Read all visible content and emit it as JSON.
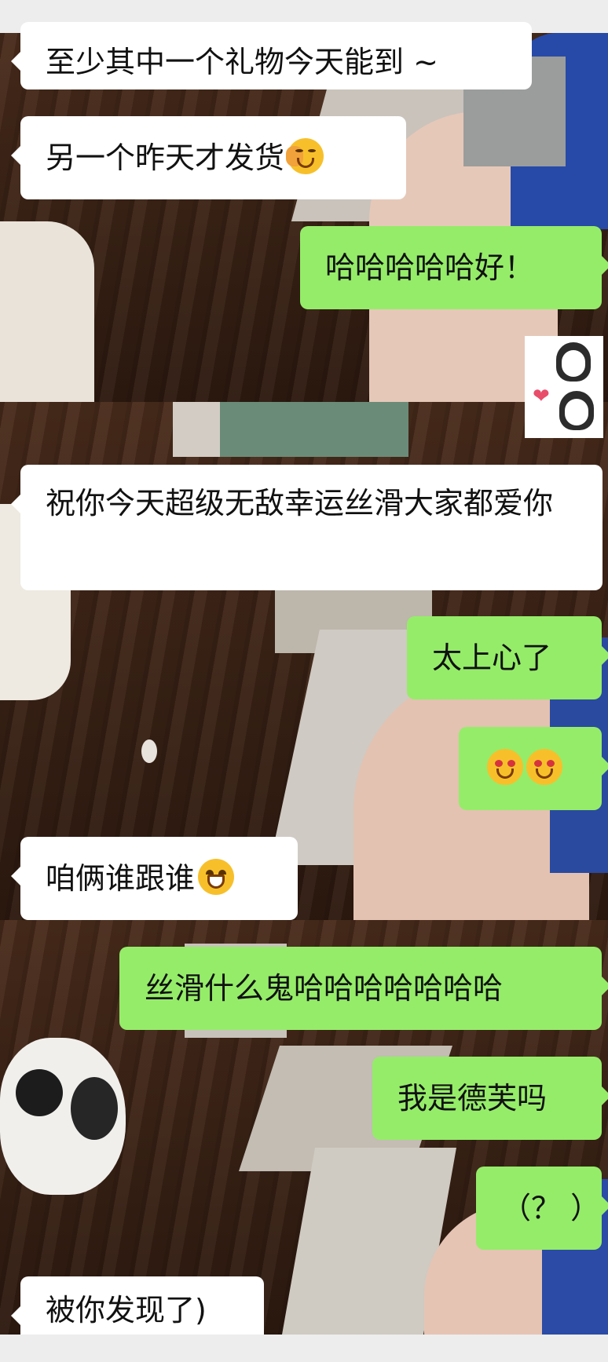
{
  "messages": [
    {
      "side": "left",
      "text": "至少其中一个礼物今天能到 ~",
      "emoji": null
    },
    {
      "side": "left",
      "text": "另一个昨天才发货",
      "emoji": "face-palm-emoji"
    },
    {
      "side": "right",
      "text": "哈哈哈哈哈好！",
      "emoji": null
    },
    {
      "side": "right",
      "sticker": "penguin-heart-sticker"
    },
    {
      "side": "left",
      "text": "祝你今天超级无敌幸运丝滑大家都爱你",
      "emoji": null
    },
    {
      "side": "right",
      "text": "太上心了",
      "emoji": null
    },
    {
      "side": "right",
      "text": "",
      "emoji": "heart-eyes-emoji x2"
    },
    {
      "side": "left",
      "text": "咱俩谁跟谁",
      "emoji": "grin-emoji"
    },
    {
      "side": "right",
      "text": "丝滑什么鬼哈哈哈哈哈哈哈",
      "emoji": null
    },
    {
      "side": "right",
      "text": "我是德芙吗",
      "emoji": null
    },
    {
      "side": "right",
      "text": "（？ ）",
      "emoji": null
    },
    {
      "side": "left",
      "text": "被你发现了)",
      "emoji": null
    }
  ],
  "colors": {
    "bubble_left": "#ffffff",
    "bubble_right": "#95ec69",
    "text": "#111111"
  }
}
